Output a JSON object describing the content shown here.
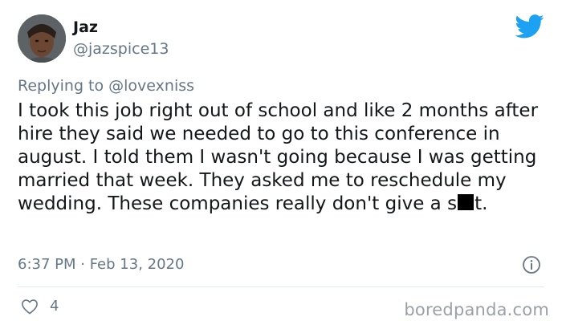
{
  "user": {
    "display_name": "Jaz",
    "handle": "@jazspice13"
  },
  "reply": {
    "prefix": "Replying to ",
    "mention": "@lovexniss"
  },
  "tweet": {
    "text_before_redaction": "I took this job right out of school and like 2 months after hire they said we needed to go to this conference in august. I told them I wasn't going because I was getting married that week. They asked me to reschedule my wedding. These companies really don't give a s",
    "text_after_redaction": "t."
  },
  "meta": {
    "timestamp": "6:37 PM · Feb 13, 2020"
  },
  "actions": {
    "like_count": "4"
  },
  "watermark": "boredpanda.com",
  "colors": {
    "twitter_blue": "#1da1f2",
    "secondary_text": "#657786",
    "divider": "#e1e8ed"
  },
  "icons": {
    "brand": "twitter-bird-icon",
    "info": "info-icon",
    "like": "heart-icon"
  }
}
